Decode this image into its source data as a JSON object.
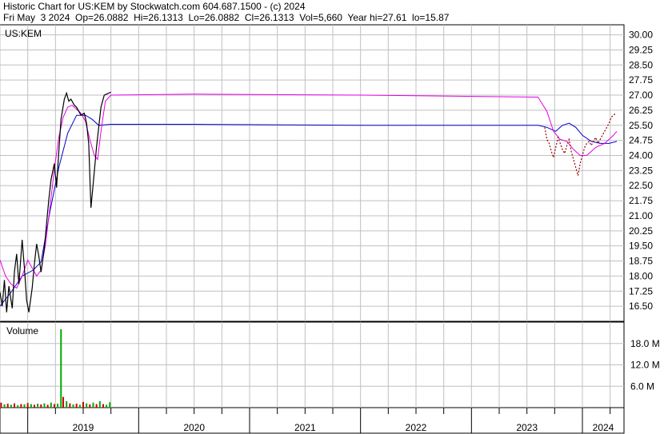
{
  "header": {
    "line1": "Historic Chart for US:KEM by Stockwatch.com 604.687.1500 - (c) 2024",
    "line2": "Fri May  3 2024  Op=26.0882  Hi=26.1313  Lo=26.0882  Cl=26.1313  Vol=5,660  Year hi=27.61  lo=15.87"
  },
  "chart_data": {
    "type": "line",
    "symbol_label": "US:KEM",
    "volume_label": "Volume",
    "colors": {
      "price": "#000000",
      "price_recent": "#990000",
      "ma_short": "#e600e6",
      "ma_long": "#0000cc",
      "volume_up": "#00aa00",
      "volume_down": "#cc0000",
      "grid": "#c0c0c0"
    },
    "ylim": [
      15.75,
      30.5
    ],
    "y_ticks": [
      "30.00",
      "29.25",
      "28.50",
      "27.75",
      "27.00",
      "26.25",
      "25.50",
      "24.75",
      "24.00",
      "23.25",
      "22.50",
      "21.75",
      "21.00",
      "20.25",
      "19.50",
      "18.75",
      "18.00",
      "17.25",
      "16.50"
    ],
    "volume_ticks": [
      "18.0 M",
      "12.0 M",
      "6.0 M"
    ],
    "volume_ylim": [
      0,
      24
    ],
    "year_labels": [
      "2019",
      "2020",
      "2021",
      "2022",
      "2023",
      "2024"
    ],
    "xlim": [
      2018.75,
      2024.375
    ],
    "price_points": [
      [
        2018.75,
        17.2
      ],
      [
        2018.77,
        16.5
      ],
      [
        2018.79,
        17.8
      ],
      [
        2018.81,
        16.2
      ],
      [
        2018.83,
        17.5
      ],
      [
        2018.86,
        16.4
      ],
      [
        2018.88,
        18.2
      ],
      [
        2018.9,
        19.1
      ],
      [
        2018.92,
        17.6
      ],
      [
        2018.95,
        19.8
      ],
      [
        2018.97,
        18.4
      ],
      [
        2018.99,
        16.8
      ],
      [
        2019.01,
        16.2
      ],
      [
        2019.04,
        17.4
      ],
      [
        2019.06,
        18.6
      ],
      [
        2019.08,
        19.6
      ],
      [
        2019.1,
        19.0
      ],
      [
        2019.12,
        18.2
      ],
      [
        2019.15,
        19.4
      ],
      [
        2019.17,
        20.6
      ],
      [
        2019.19,
        21.8
      ],
      [
        2019.21,
        22.8
      ],
      [
        2019.24,
        23.6
      ],
      [
        2019.26,
        22.4
      ],
      [
        2019.28,
        24.2
      ],
      [
        2019.3,
        25.8
      ],
      [
        2019.33,
        26.8
      ],
      [
        2019.35,
        27.1
      ],
      [
        2019.37,
        26.7
      ],
      [
        2019.39,
        26.8
      ],
      [
        2019.42,
        26.5
      ],
      [
        2019.44,
        26.4
      ],
      [
        2019.46,
        26.2
      ],
      [
        2019.48,
        26.0
      ],
      [
        2019.51,
        26.1
      ],
      [
        2019.53,
        25.6
      ],
      [
        2019.55,
        24.6
      ],
      [
        2019.57,
        21.4
      ],
      [
        2019.6,
        23.2
      ],
      [
        2019.62,
        24.4
      ],
      [
        2019.64,
        25.4
      ],
      [
        2019.66,
        26.4
      ],
      [
        2019.69,
        27.0
      ],
      [
        2019.71,
        27.05
      ],
      [
        2019.73,
        27.1
      ],
      [
        2019.75,
        27.15
      ]
    ],
    "recent_points": [
      [
        2023.66,
        25.4
      ],
      [
        2023.68,
        24.8
      ],
      [
        2023.7,
        24.6
      ],
      [
        2023.72,
        24.2
      ],
      [
        2023.74,
        23.9
      ],
      [
        2023.76,
        24.4
      ],
      [
        2023.78,
        24.9
      ],
      [
        2023.8,
        24.6
      ],
      [
        2023.82,
        24.3
      ],
      [
        2023.84,
        24.1
      ],
      [
        2023.86,
        24.5
      ],
      [
        2023.88,
        24.8
      ],
      [
        2023.9,
        24.2
      ],
      [
        2023.92,
        23.8
      ],
      [
        2023.94,
        23.4
      ],
      [
        2023.96,
        23.0
      ],
      [
        2023.98,
        23.6
      ],
      [
        2024.0,
        24.0
      ],
      [
        2024.02,
        24.4
      ],
      [
        2024.04,
        24.6
      ],
      [
        2024.06,
        24.7
      ],
      [
        2024.08,
        24.5
      ],
      [
        2024.1,
        24.7
      ],
      [
        2024.12,
        24.9
      ],
      [
        2024.14,
        24.6
      ],
      [
        2024.16,
        24.8
      ],
      [
        2024.18,
        25.0
      ],
      [
        2024.2,
        25.2
      ],
      [
        2024.22,
        25.4
      ],
      [
        2024.24,
        25.6
      ],
      [
        2024.26,
        25.9
      ],
      [
        2024.28,
        26.0
      ],
      [
        2024.3,
        26.1
      ]
    ],
    "ma_short": [
      [
        2018.75,
        18.8
      ],
      [
        2018.8,
        18.0
      ],
      [
        2018.85,
        17.6
      ],
      [
        2018.9,
        17.4
      ],
      [
        2018.95,
        18.0
      ],
      [
        2019.0,
        18.8
      ],
      [
        2019.04,
        18.4
      ],
      [
        2019.08,
        18.0
      ],
      [
        2019.12,
        18.3
      ],
      [
        2019.16,
        19.6
      ],
      [
        2019.2,
        21.4
      ],
      [
        2019.24,
        23.3
      ],
      [
        2019.28,
        24.9
      ],
      [
        2019.32,
        25.9
      ],
      [
        2019.36,
        26.4
      ],
      [
        2019.4,
        26.5
      ],
      [
        2019.44,
        26.3
      ],
      [
        2019.48,
        26.1
      ],
      [
        2019.52,
        25.7
      ],
      [
        2019.56,
        24.8
      ],
      [
        2019.6,
        24.0
      ],
      [
        2019.63,
        23.8
      ],
      [
        2019.66,
        25.2
      ],
      [
        2019.7,
        26.7
      ],
      [
        2019.75,
        27.0
      ],
      [
        2020.5,
        27.05
      ],
      [
        2022.0,
        27.0
      ],
      [
        2023.6,
        26.9
      ],
      [
        2023.68,
        26.2
      ],
      [
        2023.74,
        25.2
      ],
      [
        2023.8,
        24.8
      ],
      [
        2023.86,
        24.7
      ],
      [
        2023.92,
        24.3
      ],
      [
        2023.98,
        24.0
      ],
      [
        2024.04,
        24.0
      ],
      [
        2024.12,
        24.4
      ],
      [
        2024.2,
        24.6
      ],
      [
        2024.28,
        25.0
      ],
      [
        2024.31,
        25.2
      ]
    ],
    "ma_long": [
      [
        2018.75,
        16.5
      ],
      [
        2018.85,
        17.2
      ],
      [
        2018.95,
        18.0
      ],
      [
        2019.05,
        18.3
      ],
      [
        2019.12,
        18.7
      ],
      [
        2019.2,
        21.2
      ],
      [
        2019.28,
        23.4
      ],
      [
        2019.36,
        25.1
      ],
      [
        2019.44,
        26.0
      ],
      [
        2019.52,
        26.0
      ],
      [
        2019.58,
        25.8
      ],
      [
        2019.64,
        25.5
      ],
      [
        2019.75,
        25.55
      ],
      [
        2020.5,
        25.55
      ],
      [
        2022.0,
        25.5
      ],
      [
        2023.6,
        25.5
      ],
      [
        2023.68,
        25.4
      ],
      [
        2023.76,
        25.2
      ],
      [
        2023.82,
        25.5
      ],
      [
        2023.88,
        25.6
      ],
      [
        2023.94,
        25.4
      ],
      [
        2024.0,
        25.0
      ],
      [
        2024.08,
        24.7
      ],
      [
        2024.16,
        24.6
      ],
      [
        2024.24,
        24.6
      ],
      [
        2024.31,
        24.7
      ]
    ],
    "volume_bars": [
      [
        2018.76,
        1.4,
        "down"
      ],
      [
        2018.79,
        0.9,
        "up"
      ],
      [
        2018.82,
        1.1,
        "down"
      ],
      [
        2018.85,
        0.8,
        "up"
      ],
      [
        2018.88,
        1.2,
        "down"
      ],
      [
        2018.91,
        0.7,
        "up"
      ],
      [
        2018.94,
        1.0,
        "down"
      ],
      [
        2018.97,
        0.9,
        "up"
      ],
      [
        2019.0,
        1.3,
        "down"
      ],
      [
        2019.03,
        1.0,
        "up"
      ],
      [
        2019.06,
        0.8,
        "down"
      ],
      [
        2019.09,
        1.1,
        "up"
      ],
      [
        2019.12,
        0.9,
        "down"
      ],
      [
        2019.15,
        1.2,
        "up"
      ],
      [
        2019.18,
        0.8,
        "down"
      ],
      [
        2019.21,
        1.4,
        "up"
      ],
      [
        2019.24,
        1.0,
        "down"
      ],
      [
        2019.27,
        1.1,
        "up"
      ],
      [
        2019.3,
        22.0,
        "up"
      ],
      [
        2019.32,
        3.0,
        "down"
      ],
      [
        2019.35,
        1.8,
        "up"
      ],
      [
        2019.38,
        1.2,
        "down"
      ],
      [
        2019.41,
        0.9,
        "up"
      ],
      [
        2019.44,
        1.1,
        "down"
      ],
      [
        2019.47,
        0.8,
        "up"
      ],
      [
        2019.5,
        1.6,
        "down"
      ],
      [
        2019.53,
        1.2,
        "up"
      ],
      [
        2019.56,
        0.9,
        "down"
      ],
      [
        2019.59,
        1.4,
        "up"
      ],
      [
        2019.62,
        1.0,
        "down"
      ],
      [
        2019.65,
        1.8,
        "up"
      ],
      [
        2019.68,
        1.0,
        "down"
      ],
      [
        2019.71,
        0.8,
        "up"
      ],
      [
        2019.74,
        1.5,
        "up"
      ],
      [
        2023.66,
        0.15,
        "down"
      ],
      [
        2023.8,
        0.15,
        "down"
      ],
      [
        2023.95,
        0.15,
        "down"
      ],
      [
        2024.1,
        0.15,
        "down"
      ],
      [
        2024.25,
        0.15,
        "down"
      ]
    ]
  }
}
